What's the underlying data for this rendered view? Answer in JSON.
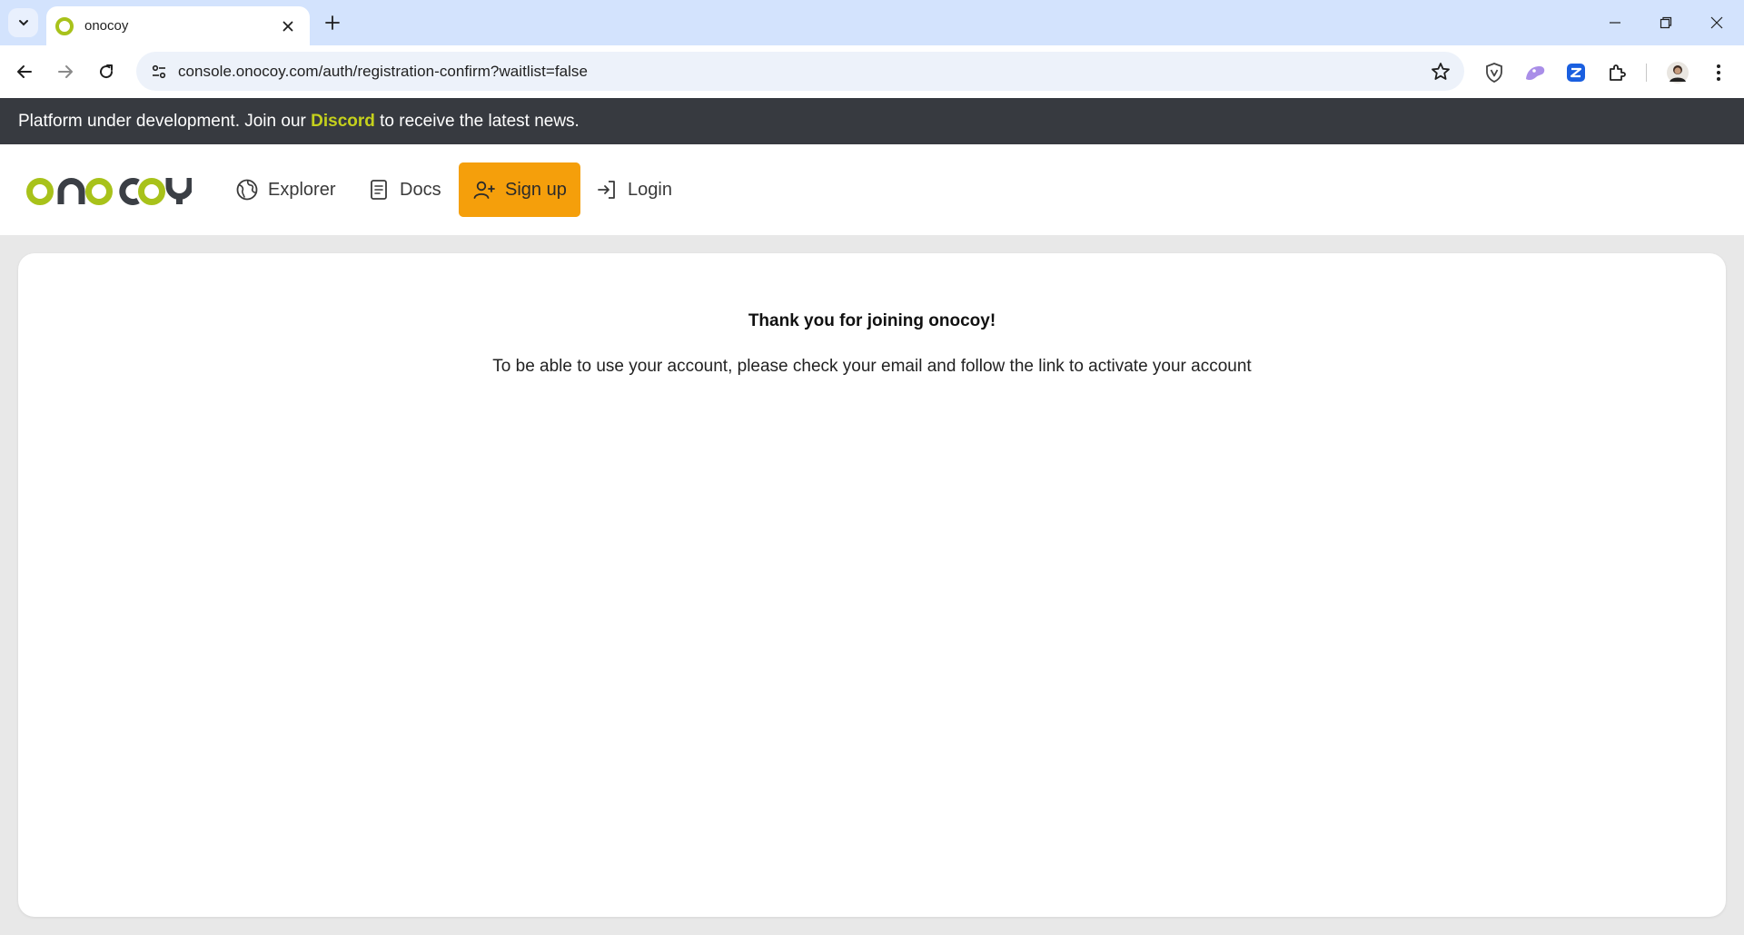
{
  "browser": {
    "tab_title": "onocoy",
    "url": "console.onocoy.com/auth/registration-confirm?waitlist=false",
    "icons": {
      "tab_search": "chevron-down-icon",
      "close_tab": "close-icon",
      "new_tab": "plus-icon",
      "minimize": "minimize-icon",
      "restore": "restore-icon",
      "close_window": "close-icon",
      "back": "arrow-left-icon",
      "forward": "arrow-right-icon",
      "reload": "reload-icon",
      "site_info": "tune-icon",
      "bookmark": "star-icon",
      "extensions": [
        "shield-v-icon",
        "lilac-extension-icon",
        "blue-extension-icon",
        "puzzle-icon"
      ],
      "profile": "avatar",
      "menu": "more-vertical-icon"
    }
  },
  "banner": {
    "prefix": "Platform under development. Join our ",
    "link": "Discord",
    "suffix": " to receive the latest news.",
    "link_color": "#c5d11c",
    "background": "#373a40"
  },
  "nav": {
    "logo": "onocoy",
    "items": [
      {
        "label": "Explorer",
        "icon": "globe-icon"
      },
      {
        "label": "Docs",
        "icon": "document-icon"
      },
      {
        "label": "Sign up",
        "icon": "add-user-icon",
        "highlight_color": "#f59f0b"
      },
      {
        "label": "Login",
        "icon": "login-icon"
      }
    ]
  },
  "main": {
    "title": "Thank you for joining onocoy!",
    "message": "To be able to use your account, please check your email and follow the link to activate your account"
  }
}
